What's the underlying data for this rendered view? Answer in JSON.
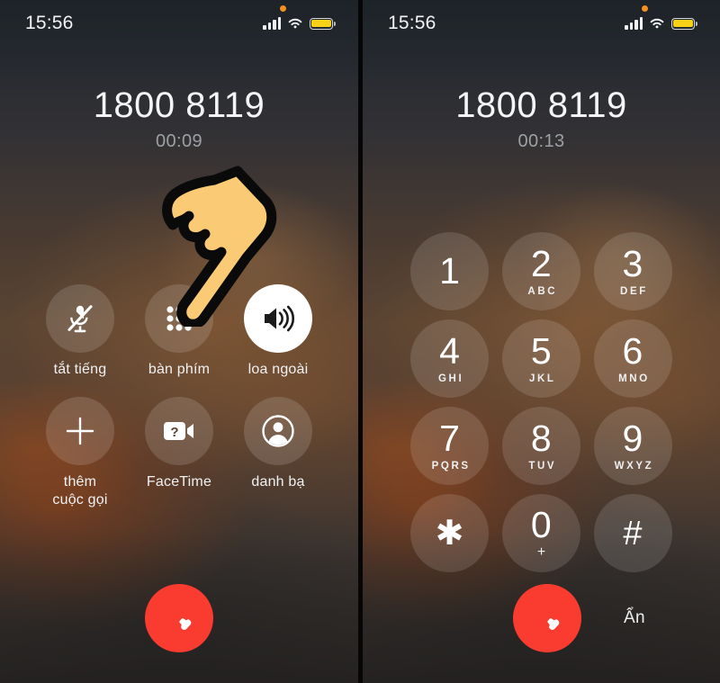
{
  "screen": {
    "status_bar": {
      "time": "15:56",
      "icons": [
        "recording-dot",
        "cellular-signal",
        "wifi",
        "battery-low-power"
      ],
      "battery_color": "#f7d117",
      "recording_dot_color": "#f59021"
    },
    "call": {
      "number": "1800 8119",
      "timer_left": "00:09",
      "timer_right": "00:13"
    }
  },
  "left_panel": {
    "controls": [
      {
        "label": "tắt tiếng",
        "icon": "microphone-slash-icon",
        "active": false
      },
      {
        "label": "bàn phím",
        "icon": "keypad-grid-icon",
        "active": false
      },
      {
        "label": "loa ngoài",
        "icon": "speaker-wave-icon",
        "active": true
      },
      {
        "label": "thêm\ncuộc gọi",
        "icon": "plus-icon",
        "active": false
      },
      {
        "label": "FaceTime",
        "icon": "video-camera-question-icon",
        "active": false
      },
      {
        "label": "danh bạ",
        "icon": "person-circle-icon",
        "active": false
      }
    ],
    "end_call": {
      "label": "",
      "icon": "end-call-handset-icon",
      "color": "#fa3c30"
    }
  },
  "right_panel": {
    "keypad": [
      {
        "digit": "1",
        "letters": ""
      },
      {
        "digit": "2",
        "letters": "ABC"
      },
      {
        "digit": "3",
        "letters": "DEF"
      },
      {
        "digit": "4",
        "letters": "GHI"
      },
      {
        "digit": "5",
        "letters": "JKL"
      },
      {
        "digit": "6",
        "letters": "MNO"
      },
      {
        "digit": "7",
        "letters": "PQRS"
      },
      {
        "digit": "8",
        "letters": "TUV"
      },
      {
        "digit": "9",
        "letters": "WXYZ"
      },
      {
        "digit": "✱",
        "letters": ""
      },
      {
        "digit": "0",
        "letters": "+"
      },
      {
        "digit": "#",
        "letters": ""
      }
    ],
    "end_call": {
      "icon": "end-call-handset-icon",
      "color": "#fa3c30"
    },
    "hide_label": "Ẩn"
  },
  "annotations": {
    "hand_left": "pointing-hand-cursor",
    "hand_right": "pointing-hand-cursor"
  }
}
